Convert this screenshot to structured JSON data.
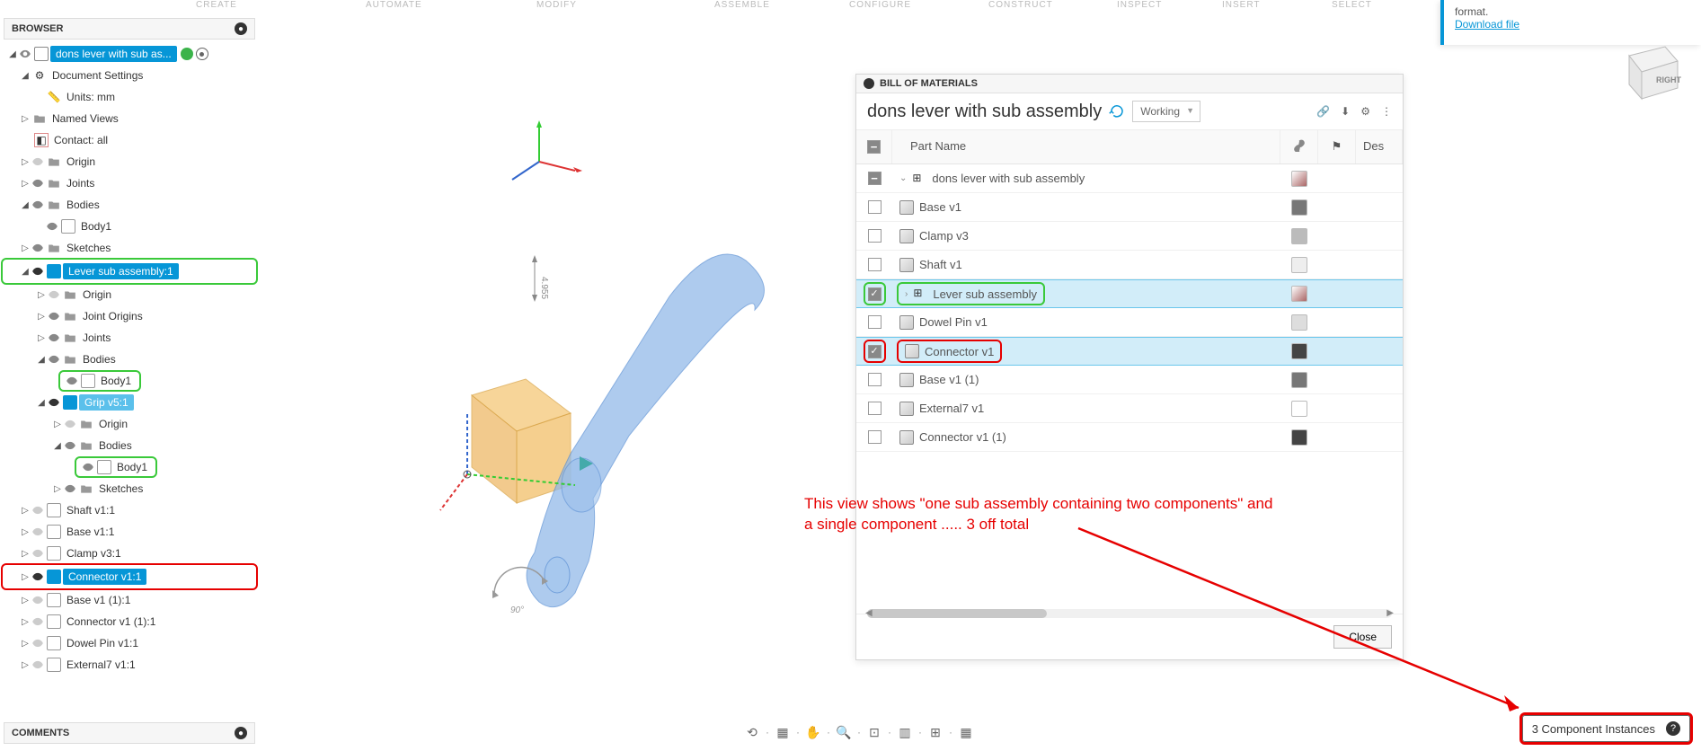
{
  "top_menu": {
    "create": "CREATE",
    "automate": "AUTOMATE",
    "modify": "MODIFY",
    "assemble": "ASSEMBLE",
    "configure": "CONFIGURE",
    "construct": "CONSTRUCT",
    "inspect": "INSPECT",
    "insert": "INSERT",
    "select": "SELECT"
  },
  "browser": {
    "title": "BROWSER",
    "root_label": "dons lever with sub as...",
    "doc_settings": "Document Settings",
    "units": "Units: mm",
    "named_views": "Named Views",
    "contact": "Contact: all",
    "origin": "Origin",
    "joints": "Joints",
    "bodies": "Bodies",
    "body1": "Body1",
    "sketches": "Sketches",
    "lever_sub": "Lever sub assembly:1",
    "joint_origins": "Joint Origins",
    "grip": "Grip v5:1",
    "shaft": "Shaft v1:1",
    "base": "Base v1:1",
    "clamp": "Clamp v3:1",
    "connector": "Connector v1:1",
    "base2": "Base v1 (1):1",
    "connector2": "Connector v1 (1):1",
    "dowel": "Dowel Pin v1:1",
    "external": "External7 v1:1"
  },
  "comments": {
    "title": "COMMENTS"
  },
  "bom": {
    "panel_title": "BILL OF MATERIALS",
    "title": "dons lever with sub assembly",
    "working": "Working",
    "headers": {
      "part_name": "Part Name",
      "des": "Des"
    },
    "rows": {
      "root": "dons lever with sub assembly",
      "base": "Base v1",
      "clamp": "Clamp v3",
      "shaft": "Shaft v1",
      "lever_sub": "Lever sub assembly",
      "dowel": "Dowel Pin v1",
      "connector": "Connector v1",
      "base2": "Base v1 (1)",
      "external": "External7 v1",
      "connector2": "Connector v1 (1)"
    },
    "close": "Close"
  },
  "annotation": {
    "line1": "This view shows \"one sub assembly containing two components\" and",
    "line2": "a single component  .....   3 off total"
  },
  "status": {
    "instances": "3 Component Instances"
  },
  "notif": {
    "text": "format.",
    "link": "Download file"
  }
}
